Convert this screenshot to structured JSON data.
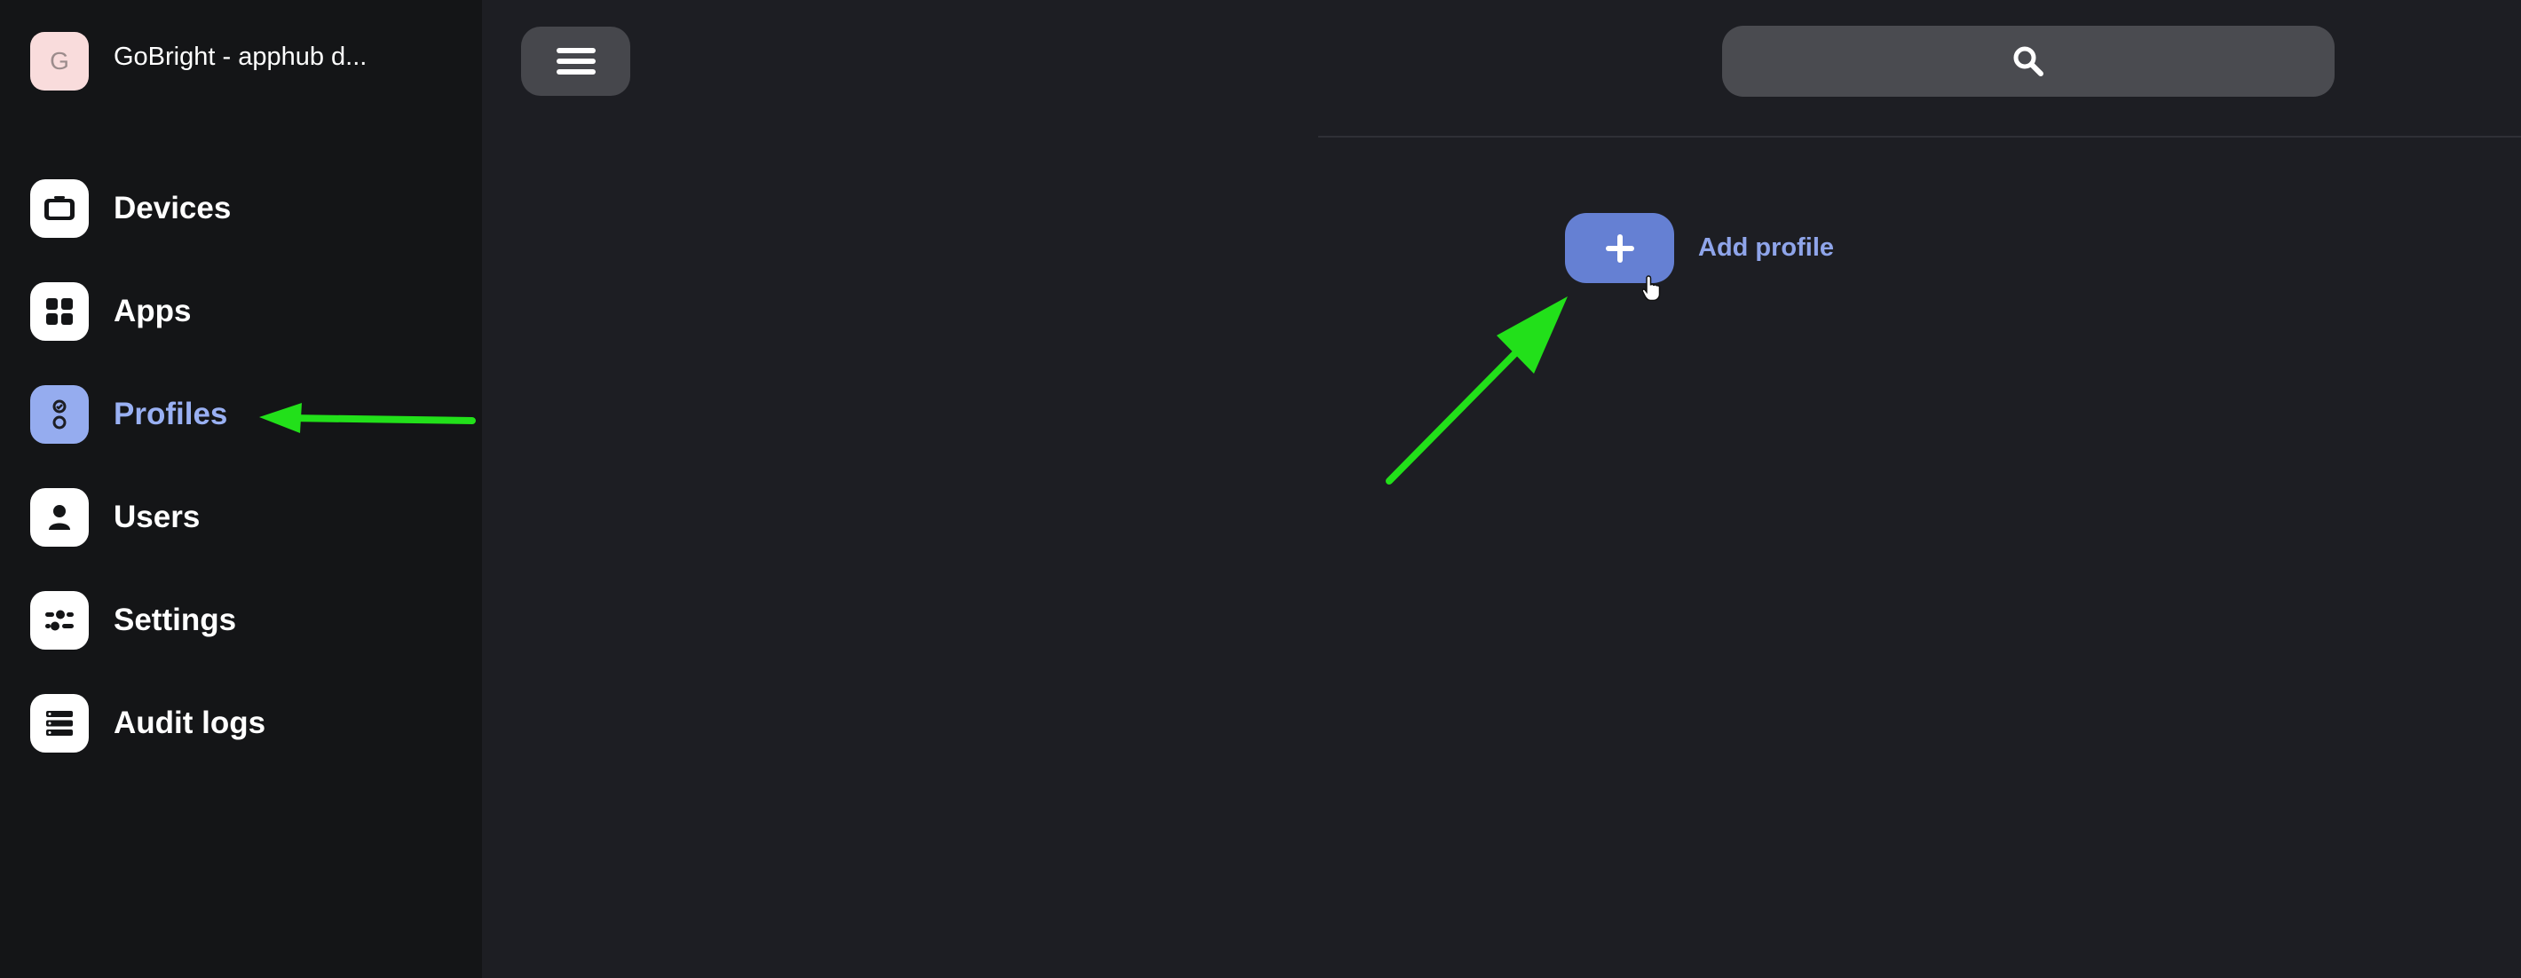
{
  "org": {
    "initial": "G",
    "name": "GoBright - apphub d..."
  },
  "sidebar": {
    "items": [
      {
        "label": "Devices",
        "icon": "devices-icon",
        "active": false
      },
      {
        "label": "Apps",
        "icon": "apps-grid-icon",
        "active": false
      },
      {
        "label": "Profiles",
        "icon": "profiles-icon",
        "active": true
      },
      {
        "label": "Users",
        "icon": "user-icon",
        "active": false
      },
      {
        "label": "Settings",
        "icon": "settings-sliders-icon",
        "active": false
      },
      {
        "label": "Audit logs",
        "icon": "audit-logs-icon",
        "active": false
      }
    ]
  },
  "header": {
    "menu_icon": "hamburger-menu-icon",
    "search_icon": "search-icon"
  },
  "main": {
    "add_profile_label": "Add profile",
    "add_icon": "plus-icon"
  },
  "colors": {
    "background": "#1d1e23",
    "sidebar": "#141517",
    "accent": "#6580d3",
    "accent_text": "#99b0f3",
    "annotation_arrow": "#22e01a"
  }
}
